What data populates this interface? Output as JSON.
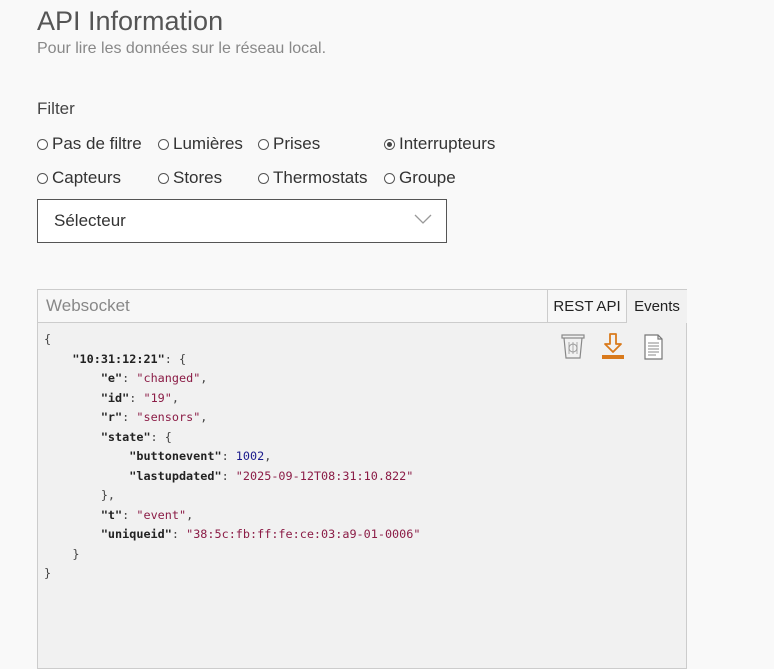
{
  "header": {
    "title": "API Information",
    "subtitle": "Pour lire les données sur le réseau local."
  },
  "filter": {
    "label": "Filter",
    "options": [
      {
        "label": "Pas de filtre",
        "selected": false
      },
      {
        "label": "Lumières",
        "selected": false
      },
      {
        "label": "Prises",
        "selected": false
      },
      {
        "label": "Interrupteurs",
        "selected": true
      },
      {
        "label": "Capteurs",
        "selected": false
      },
      {
        "label": "Stores",
        "selected": false
      },
      {
        "label": "Thermostats",
        "selected": false
      },
      {
        "label": "Groupe",
        "selected": false
      }
    ],
    "selector_value": "Sélecteur"
  },
  "panel": {
    "title": "Websocket",
    "tabs": [
      {
        "label": "REST API",
        "active": false
      },
      {
        "label": "Events",
        "active": true
      }
    ],
    "icons": [
      "trash-icon",
      "download-icon",
      "copy-icon"
    ],
    "accent": "#d97a1c"
  },
  "event": {
    "timestamp_key": "10:31:12:21",
    "e": "changed",
    "id": "19",
    "r": "sensors",
    "state": {
      "buttonevent": "1002",
      "lastupdated": "2025-09-12T08:31:10.822"
    },
    "t": "event",
    "uniqueid": "38:5c:fb:ff:fe:ce:03:a9-01-0006"
  }
}
